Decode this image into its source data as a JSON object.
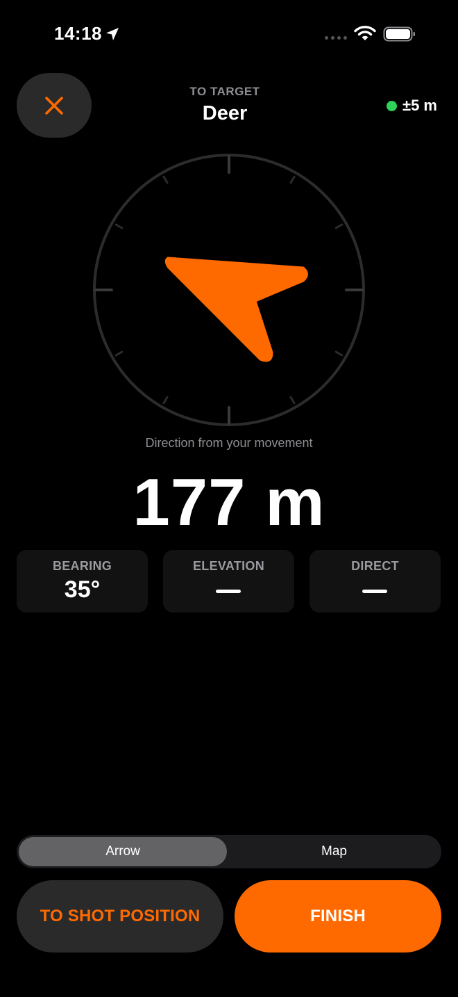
{
  "status_bar": {
    "time": "14:18",
    "icons": [
      "location-arrow-icon",
      "cellular-signal-icon",
      "wifi-icon",
      "battery-icon"
    ]
  },
  "header": {
    "close_icon": "close-icon",
    "subtitle": "TO TARGET",
    "title": "Deer",
    "gps_accuracy": "±5 m",
    "gps_status_color": "#30d158"
  },
  "compass": {
    "arrow_heading_deg": 305,
    "caption": "Direction from your movement"
  },
  "distance": "177 m",
  "stats": [
    {
      "label": "BEARING",
      "value": "35°"
    },
    {
      "label": "ELEVATION",
      "value": null
    },
    {
      "label": "DIRECT",
      "value": null
    }
  ],
  "view_mode": {
    "options": [
      "Arrow",
      "Map"
    ],
    "selected": "Arrow"
  },
  "buttons": {
    "shot_position": "TO SHOT POSITION",
    "finish": "FINISH"
  },
  "colors": {
    "accent": "#ff6a00",
    "background": "#000000",
    "card": "#121212",
    "secondary_text": "#8e8e93"
  }
}
